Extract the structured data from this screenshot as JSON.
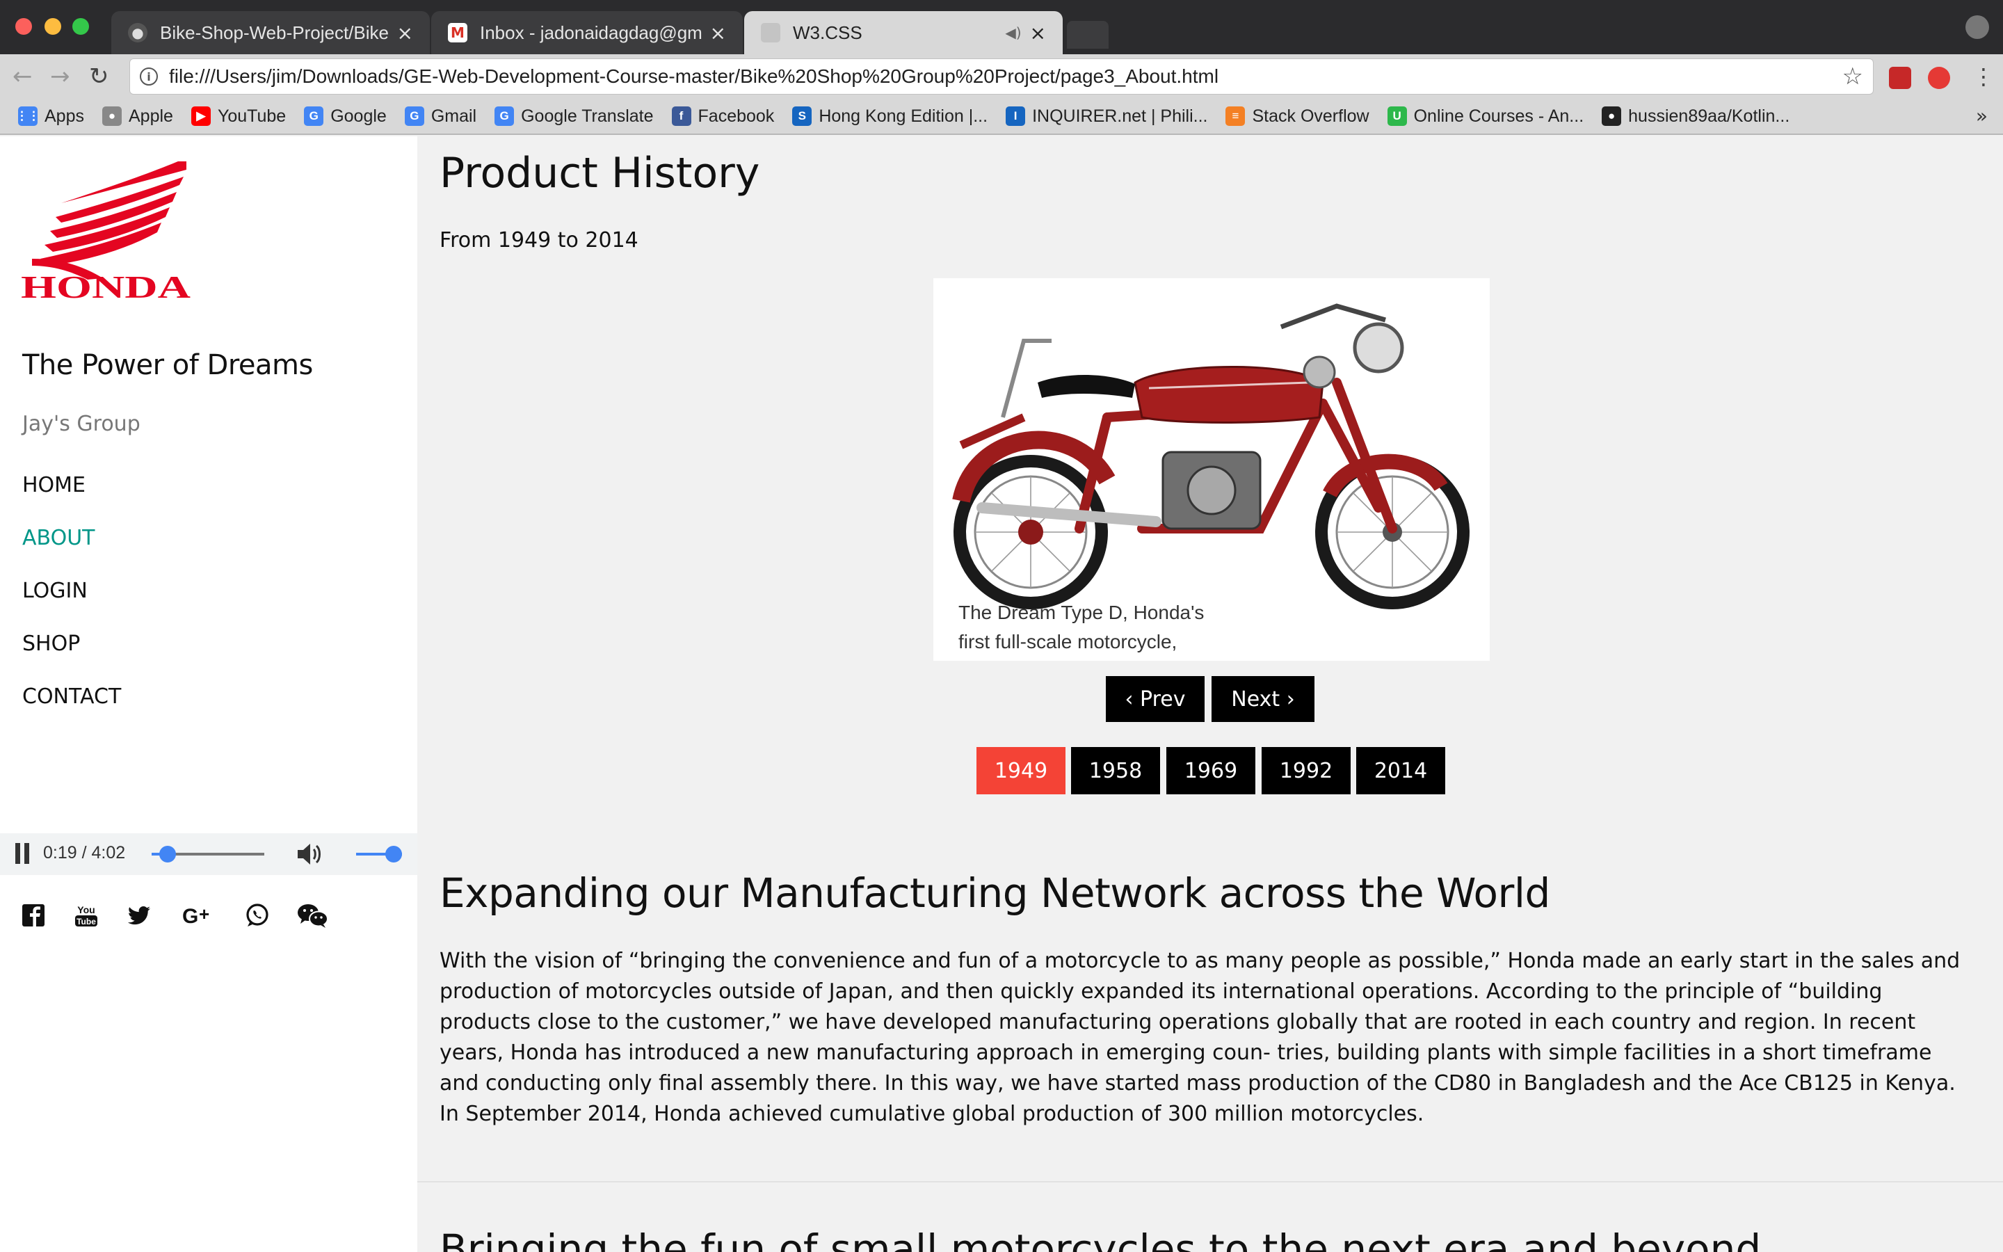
{
  "browser": {
    "tabs": [
      {
        "label": "Bike-Shop-Web-Project/Bike S",
        "active": false,
        "favicon": "github-icon"
      },
      {
        "label": "Inbox - jadonaidagdag@gmail.c",
        "active": false,
        "favicon": "gmail-icon"
      },
      {
        "label": "W3.CSS",
        "active": true,
        "favicon": "page-icon"
      }
    ],
    "url": "file:///Users/jim/Downloads/GE-Web-Development-Course-master/Bike%20Shop%20Group%20Project/page3_About.html",
    "bookmarks": [
      {
        "label": "Apps",
        "icon": "apps-grid-icon",
        "color": "#4285f4"
      },
      {
        "label": "Apple",
        "icon": "apple-icon",
        "color": "#888888"
      },
      {
        "label": "YouTube",
        "icon": "youtube-icon",
        "color": "#ff0000"
      },
      {
        "label": "Google",
        "icon": "google-icon",
        "color": "#4285f4"
      },
      {
        "label": "Gmail",
        "icon": "google-icon",
        "color": "#4285f4"
      },
      {
        "label": "Google Translate",
        "icon": "translate-icon",
        "color": "#4285f4"
      },
      {
        "label": "Facebook",
        "icon": "facebook-icon",
        "color": "#3b5998"
      },
      {
        "label": "Hong Kong Edition |...",
        "icon": "scmp-icon",
        "color": "#1565c0"
      },
      {
        "label": "INQUIRER.net | Phili...",
        "icon": "inquirer-icon",
        "color": "#1565c0"
      },
      {
        "label": "Stack Overflow",
        "icon": "stackoverflow-icon",
        "color": "#f48024"
      },
      {
        "label": "Online Courses - An...",
        "icon": "udemy-icon",
        "color": "#2db84b"
      },
      {
        "label": "hussien89aa/Kotlin...",
        "icon": "github-icon",
        "color": "#222222"
      }
    ]
  },
  "sidebar": {
    "brand": "HONDA",
    "brand_color": "#e40521",
    "tagline": "The Power of Dreams",
    "group": "Jay's Group",
    "nav": [
      {
        "label": "HOME",
        "active": false
      },
      {
        "label": "ABOUT",
        "active": true
      },
      {
        "label": "LOGIN",
        "active": false
      },
      {
        "label": "SHOP",
        "active": false
      },
      {
        "label": "CONTACT",
        "active": false
      }
    ],
    "active_color": "#009688",
    "social": [
      "facebook-icon",
      "youtube-icon",
      "twitter-icon",
      "google-plus-icon",
      "whatsapp-icon",
      "wechat-icon"
    ],
    "player": {
      "time": "0:19 / 4:02",
      "progress": 0.08,
      "volume": 1.0,
      "accent": "#4285f4"
    }
  },
  "main": {
    "title": "Product History",
    "subtitle": "From 1949 to 2014",
    "slide_caption_line1": "The Dream Type D, Honda's",
    "slide_caption_line2": "first full-scale motorcycle,",
    "prev_label": "‹ Prev",
    "next_label": "Next ›",
    "years": [
      "1949",
      "1958",
      "1969",
      "1992",
      "2014"
    ],
    "selected_year": "1949",
    "selected_color": "#f44336",
    "section_title": "Expanding our Manufacturing Network across the World",
    "section_text": "With the vision of “bringing the convenience and fun of a motorcycle to as many people as possible,” Honda made an early start in the sales and production of motorcycles outside of Japan, and then quickly expanded its international operations. According to the principle of “building products close to the customer,” we have developed manufacturing operations globally that are rooted in each country and region. In recent years, Honda has introduced a new manufacturing approach in emerging coun- tries, building plants with simple facilities in a short timeframe and conducting only final assembly there. In this way, we have started mass production of the CD80 in Bangladesh and the Ace CB125 in Kenya. In September 2014, Honda achieved cumulative global production of 300 million motorcycles.",
    "next_section_title": "Bringing the fun of small motorcycles to the next era and beyond"
  }
}
